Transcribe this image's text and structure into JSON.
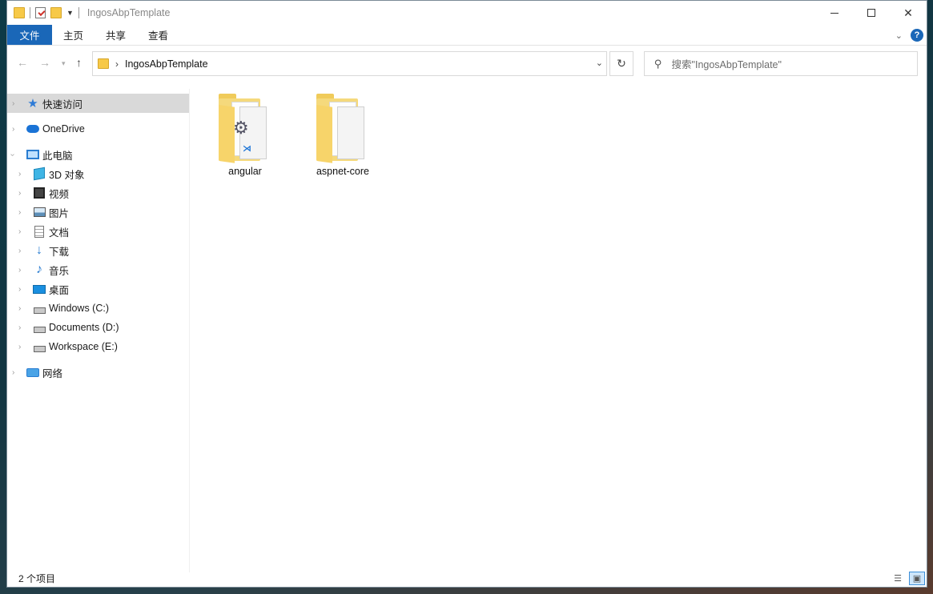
{
  "window": {
    "title": "IngosAbpTemplate"
  },
  "ribbon": {
    "tabs": [
      "文件",
      "主页",
      "共享",
      "查看"
    ]
  },
  "address": {
    "path": "IngosAbpTemplate"
  },
  "search": {
    "placeholder": "搜索\"IngosAbpTemplate\""
  },
  "nav": {
    "quick_access": "快速访问",
    "onedrive": "OneDrive",
    "this_pc": "此电脑",
    "pc_items": [
      "3D 对象",
      "视频",
      "图片",
      "文档",
      "下载",
      "音乐",
      "桌面",
      "Windows (C:)",
      "Documents (D:)",
      "Workspace (E:)"
    ],
    "network": "网络"
  },
  "items": [
    {
      "name": "angular"
    },
    {
      "name": "aspnet-core"
    }
  ],
  "status": {
    "count": "2 个项目"
  },
  "colors": {
    "accent": "#1a67b8",
    "folder": "#f7c948"
  }
}
